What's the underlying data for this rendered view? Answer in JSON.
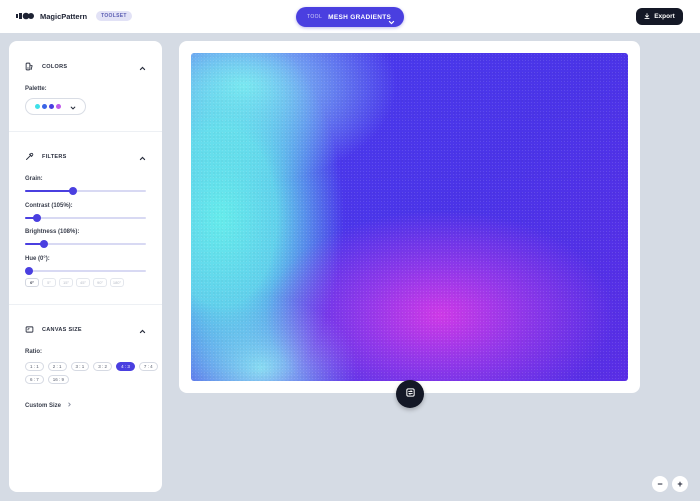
{
  "app": {
    "name": "MagicPattern",
    "badge": "TOOLSET"
  },
  "tool_selector": {
    "label": "TOOL",
    "value": "MESH GRADIENTS"
  },
  "export": {
    "label": "Export"
  },
  "colors": {
    "title": "COLORS",
    "palette_label": "Palette:",
    "palette": [
      "#3ee0e8",
      "#3b64e6",
      "#4a3fe0",
      "#c05bea"
    ]
  },
  "filters": {
    "title": "FILTERS",
    "grain": {
      "label": "Grain:",
      "value": 0.4
    },
    "contrast": {
      "label": "Contrast (105%):",
      "value": 0.1
    },
    "brightness": {
      "label": "Brightness (108%):",
      "value": 0.16
    },
    "hue": {
      "label": "Hue (0°):",
      "value": 0.0
    },
    "hue_options": [
      "0°",
      "5°",
      "15°",
      "45°",
      "90°",
      "180°"
    ]
  },
  "canvas_size": {
    "title": "CANVAS SIZE",
    "ratio_label": "Ratio:",
    "ratios_row1": [
      "1 : 1",
      "2 : 1",
      "3 : 1",
      "3 : 2",
      "4 : 3",
      "7 : 4"
    ],
    "ratios_row2": [
      "6 : 7",
      "16 : 9"
    ],
    "selected_ratio": "4 : 3",
    "custom_size_label": "Custom Size"
  },
  "zoom": {
    "out": "−",
    "in": "+"
  },
  "colors_theme": {
    "accent": "#4a3fe0",
    "dark": "#141826",
    "background": "#d5dbe4"
  }
}
